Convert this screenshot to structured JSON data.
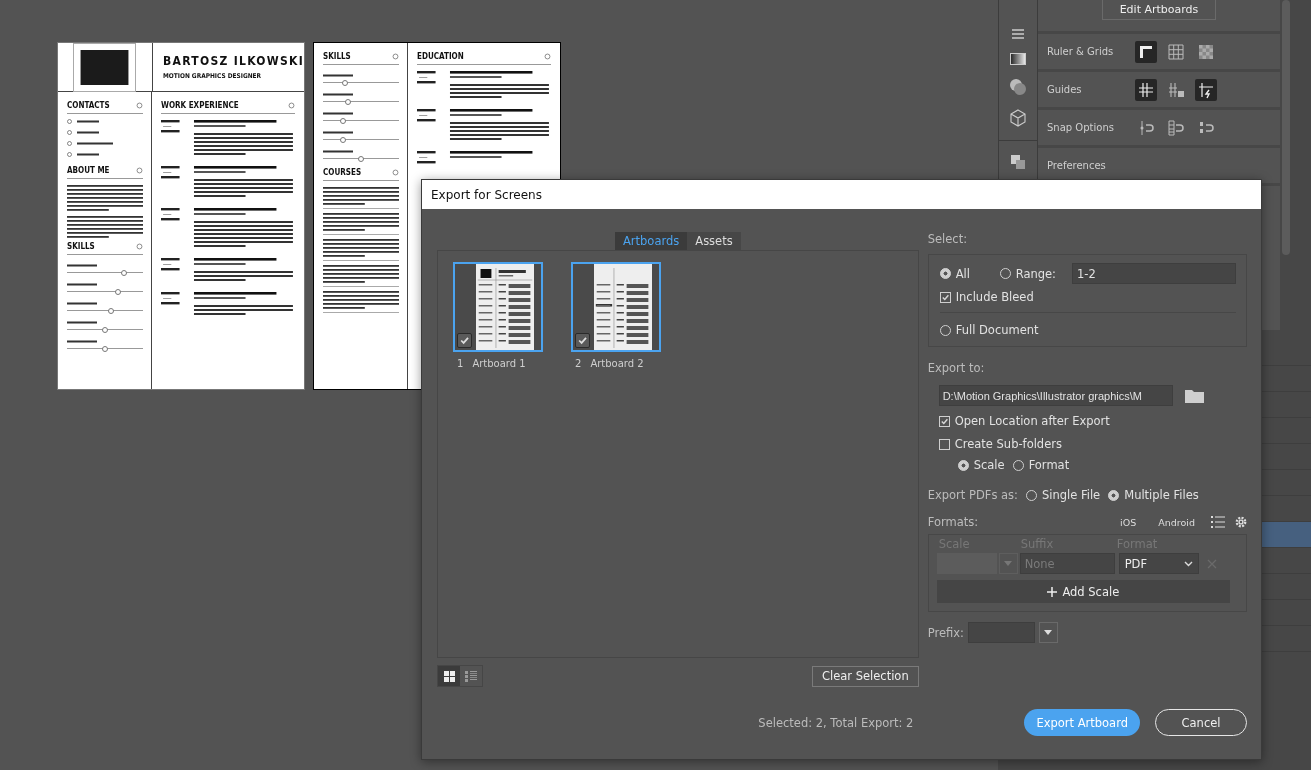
{
  "canvas": {
    "artboards": [
      {
        "kind": "resume-page-1",
        "name": "BARTOSZ ILKOWSKI",
        "subtitle": "MOTION GRAPHICS DESIGNER",
        "left_sections": [
          {
            "kind": "contacts",
            "heading": "CONTACTS"
          },
          {
            "kind": "about",
            "heading": "ABOUT ME"
          },
          {
            "kind": "skills",
            "heading": "SKILLS",
            "items": [
              {
                "level": 0.74
              },
              {
                "level": 0.66
              },
              {
                "level": 0.57
              },
              {
                "level": 0.49
              },
              {
                "level": 0.49
              }
            ]
          }
        ],
        "right_sections": [
          {
            "kind": "work",
            "heading": "WORK EXPERIENCE"
          }
        ]
      },
      {
        "kind": "resume-page-2",
        "left_sections": [
          {
            "kind": "skills",
            "heading": "SKILLS",
            "items": [
              {
                "level": 0.27
              },
              {
                "level": 0.32
              },
              {
                "level": 0.25
              },
              {
                "level": 0.25
              },
              {
                "level": 0.49
              }
            ]
          },
          {
            "kind": "courses",
            "heading": "COURSES"
          }
        ],
        "right_sections": [
          {
            "kind": "education",
            "heading": "EDUCATION"
          }
        ]
      }
    ]
  },
  "properties_panel": {
    "edit_artboards": "Edit Artboards",
    "sections": [
      {
        "label": "Ruler & Grids",
        "tools": [
          {
            "kind": "ruler",
            "on": true
          },
          {
            "kind": "grid",
            "on": false
          },
          {
            "kind": "transparency-grid",
            "on": false
          }
        ]
      },
      {
        "label": "Guides",
        "tools": [
          {
            "kind": "guides",
            "on": true
          },
          {
            "kind": "lock-guides",
            "on": false
          },
          {
            "kind": "smart-guides",
            "on": true
          }
        ]
      },
      {
        "label": "Snap Options",
        "tools": [
          {
            "kind": "snap-point",
            "on": false
          },
          {
            "kind": "snap-grid",
            "on": false
          },
          {
            "kind": "snap-pixel",
            "on": false
          }
        ]
      },
      {
        "label": "Preferences"
      }
    ]
  },
  "dialog": {
    "title": "Export for Screens",
    "tabs": [
      {
        "label": "Artboards",
        "selected": true
      },
      {
        "label": "Assets",
        "selected": false
      }
    ],
    "artboards": [
      {
        "number": "1",
        "label": "Artboard 1",
        "kind": "page-1",
        "checked": true,
        "selected": true
      },
      {
        "number": "2",
        "label": "Artboard 2",
        "kind": "page-2",
        "checked": true,
        "selected": true
      }
    ],
    "views": [
      {
        "kind": "grid",
        "selected": true
      },
      {
        "kind": "list",
        "selected": false
      }
    ],
    "clear_selection": "Clear Selection",
    "select": {
      "label": "Select:",
      "modes": [
        {
          "label": "All",
          "selected": true
        },
        {
          "label": "Range:",
          "selected": false
        },
        {
          "label": "Full Document",
          "selected": false
        }
      ],
      "range": "1-2",
      "include_bleed": {
        "label": "Include Bleed",
        "checked": true
      }
    },
    "export_to": {
      "label": "Export to:",
      "path": "D:\\Motion Graphics\\Illustrator graphics\\M",
      "options": [
        {
          "label": "Open Location after Export",
          "checked": true
        },
        {
          "label": "Create Sub-folders",
          "checked": false
        }
      ],
      "subfolders_by": [
        {
          "label": "Scale",
          "selected": true
        },
        {
          "label": "Format",
          "selected": false
        }
      ]
    },
    "export_pdfs": {
      "label": "Export PDFs as:",
      "options": [
        {
          "label": "Single File",
          "selected": false
        },
        {
          "label": "Multiple Files",
          "selected": true
        }
      ]
    },
    "formats": {
      "label": "Formats:",
      "presets": [
        "iOS",
        "Android"
      ],
      "columns": [
        "Scale",
        "Suffix",
        "Format"
      ],
      "rows": [
        {
          "suffix_placeholder": "None",
          "format": "PDF"
        }
      ],
      "add_scale": "Add Scale"
    },
    "prefix": {
      "label": "Prefix:"
    },
    "status": "Selected: 2, Total Export: 2",
    "buttons": [
      {
        "label": "Export Artboard",
        "kind": "primary"
      },
      {
        "label": "Cancel",
        "kind": "secondary"
      }
    ]
  }
}
